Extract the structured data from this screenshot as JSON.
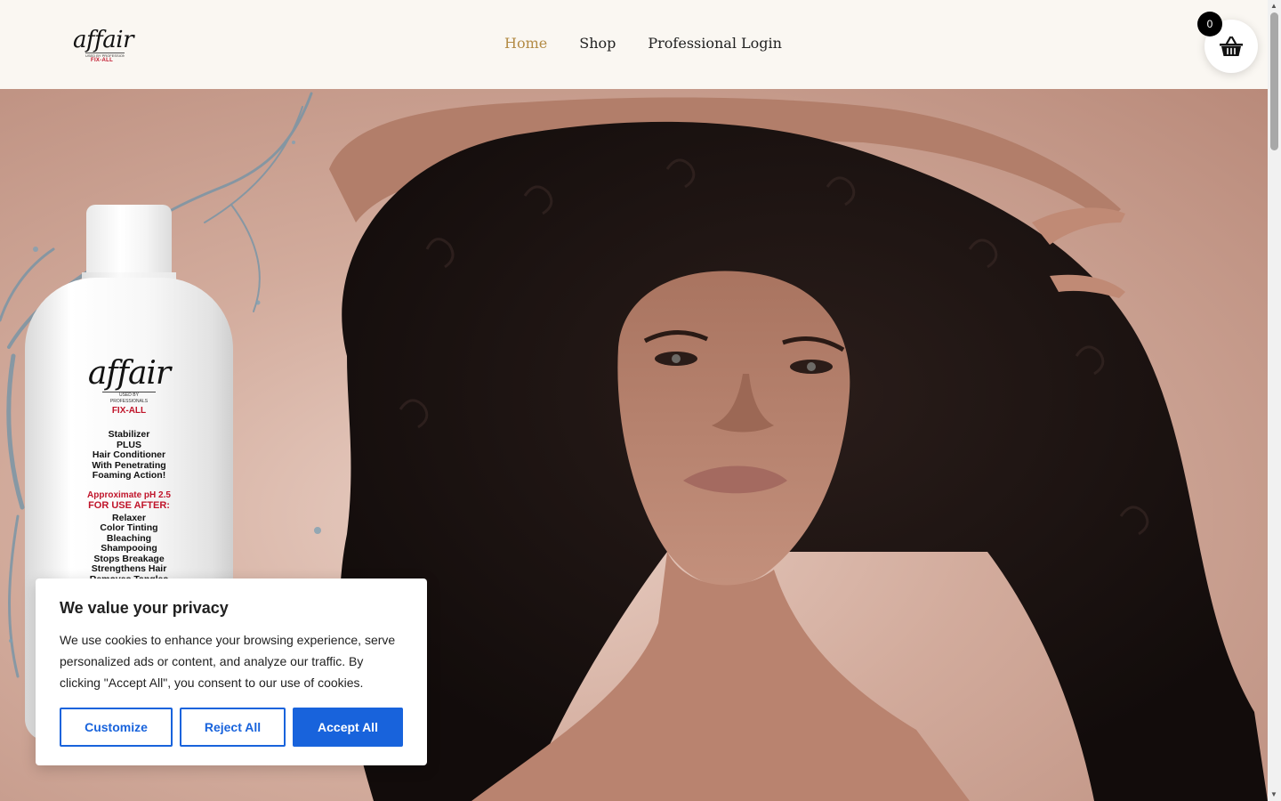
{
  "header": {
    "logo": {
      "brand": "affair",
      "tagline": "USED BY PROFESSIONALS",
      "sub": "FIX-ALL"
    },
    "nav": [
      {
        "label": "Home",
        "active": true
      },
      {
        "label": "Shop",
        "active": false
      },
      {
        "label": "Professional Login",
        "active": false
      }
    ],
    "cart": {
      "count": "0",
      "icon": "basket-icon"
    }
  },
  "hero": {
    "product": {
      "brand": "affair",
      "tagline": "USED BY PROFESSIONALS",
      "sub": "FIX-ALL",
      "description": [
        "Stabilizer",
        "PLUS",
        "Hair Conditioner",
        "With Penetrating",
        "Foaming Action!"
      ],
      "ph": "Approximate pH 2.5",
      "use_heading": "FOR USE AFTER:",
      "uses": [
        "Relaxer",
        "Color Tinting",
        "Bleaching",
        "Shampooing",
        "Stops Breakage",
        "Strengthens Hair",
        "Removes Tangles"
      ]
    }
  },
  "cookie": {
    "title": "We value your privacy",
    "text": "We use cookies to enhance your browsing experience, serve personalized ads or content, and analyze our traffic. By clicking \"Accept All\", you consent to our use of cookies.",
    "customize": "Customize",
    "reject": "Reject All",
    "accept": "Accept All"
  },
  "colors": {
    "header_bg": "#faf7f2",
    "nav_active": "#b38b45",
    "brand_red": "#c0142a",
    "cookie_blue": "#1863dc"
  }
}
